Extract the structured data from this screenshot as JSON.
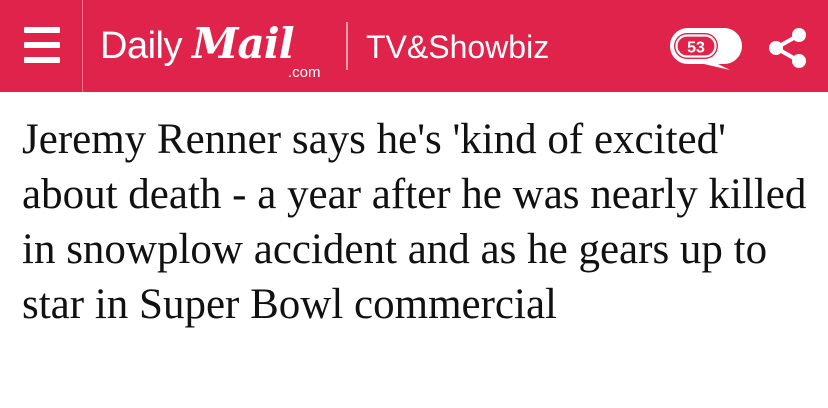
{
  "header": {
    "brand": {
      "daily": "Daily",
      "mail": "Mail",
      "domain": ".com"
    },
    "section": "TV&Showbiz",
    "comment_count": "53",
    "icons": {
      "menu": "menu-icon",
      "comments": "comment-bubble-icon",
      "share": "share-icon"
    },
    "colors": {
      "header_bg": "#e0234b",
      "header_fg": "#ffffff"
    }
  },
  "article": {
    "headline": "Jeremy Renner says he's 'kind of excited' about death - a year after he was nearly killed in snowplow accident and as he gears up to star in Super Bowl commercial"
  }
}
